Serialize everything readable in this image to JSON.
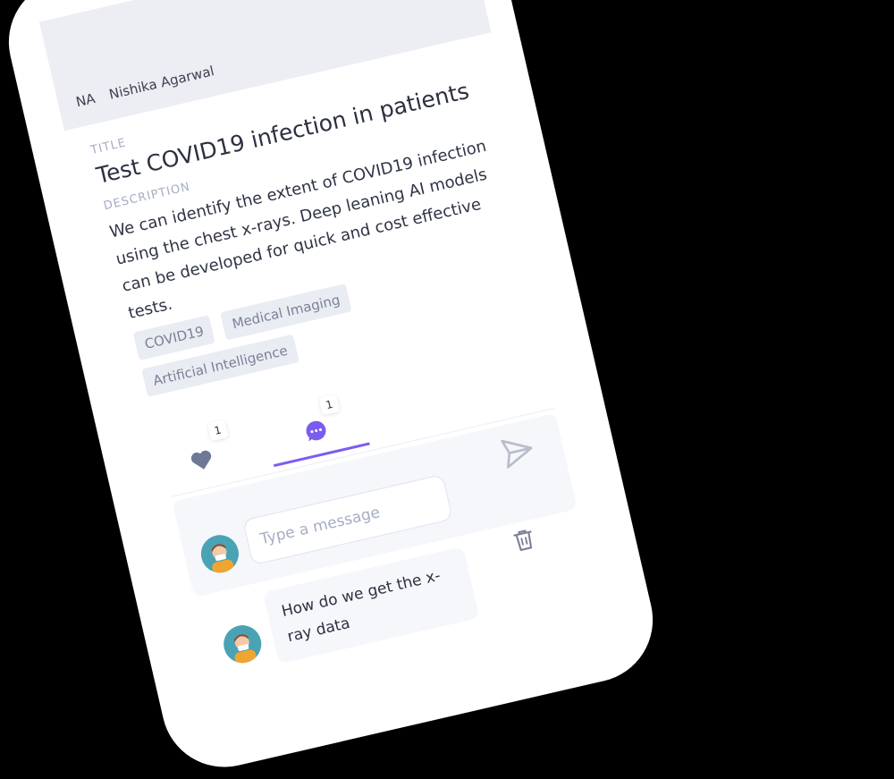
{
  "author": {
    "initials": "NA",
    "name": "Nishika Agarwal"
  },
  "post": {
    "title_label": "TITLE",
    "title": "Test COVID19 infection in patients",
    "description_label": "DESCRIPTION",
    "description": "We can identify the extent of COVID19 infection using the chest x-rays. Deep leaning AI models can be developed for quick and cost effective tests.",
    "tags": [
      "COVID19",
      "Medical Imaging",
      "Artificial Intelligence"
    ]
  },
  "tabs": {
    "likes_count": "1",
    "comments_count": "1",
    "active": "comments"
  },
  "composer": {
    "placeholder": "Type a message"
  },
  "comments": [
    {
      "text": "How do we get the x-ray data"
    }
  ],
  "colors": {
    "accent": "#7c5cf0",
    "muted": "#a6adc3",
    "heart": "#6f7896"
  },
  "icons": {
    "like": "heart-icon",
    "comment": "chat-bubble-icon",
    "send": "send-icon",
    "delete": "trash-icon"
  }
}
